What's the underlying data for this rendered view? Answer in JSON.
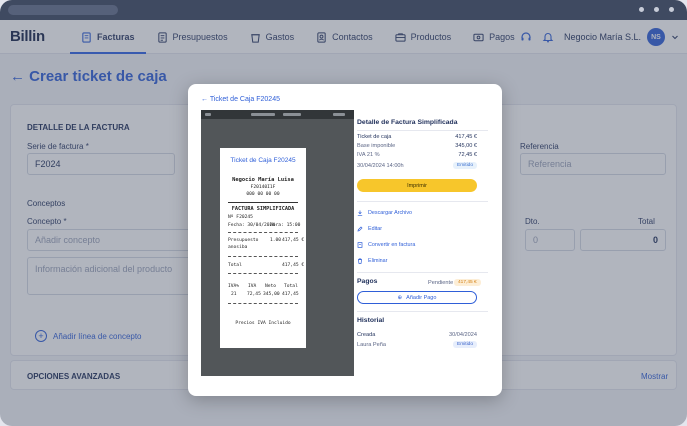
{
  "app": {
    "logo": "Billin"
  },
  "nav": [
    {
      "label": "Facturas",
      "icon": "invoice-icon",
      "active": true
    },
    {
      "label": "Presupuestos",
      "icon": "budget-icon"
    },
    {
      "label": "Gastos",
      "icon": "expenses-icon"
    },
    {
      "label": "Contactos",
      "icon": "contacts-icon"
    },
    {
      "label": "Productos",
      "icon": "products-icon"
    },
    {
      "label": "Pagos",
      "icon": "payments-icon"
    }
  ],
  "header": {
    "company": "Negocio María S.L.",
    "avatar": "NS"
  },
  "page": {
    "title": "← Crear ticket de caja",
    "detalle_title": "DETALLE DE LA FACTURA",
    "serie_label": "Serie de factura *",
    "serie_value": "F2024",
    "referencia_label": "Referencia",
    "referencia_placeholder": "Referencia",
    "conceptos_title": "Conceptos",
    "concepto_label": "Concepto *",
    "concepto_placeholder": "Añadir concepto",
    "info_placeholder": "Información adicional del producto",
    "dto_label": "Dto.",
    "dto_value": "0",
    "total_label": "Total",
    "total_value": "0",
    "add_line": "Añadir línea de concepto",
    "opciones": "OPCIONES AVANZADAS",
    "mostrar": "Mostrar"
  },
  "modal": {
    "back": "← Ticket de Caja F20245",
    "receipt": {
      "title": "Ticket de Caja F20245",
      "business": "Negocio María Luisa",
      "nif": "F20140I1F",
      "phone": "000 00 00 00",
      "doc_type": "FACTURA SIMPLIFICADA",
      "number": "Nº F20245",
      "date": "Fecha: 30/04/2024",
      "time": "Hora: 15:00",
      "item_name": "Presupuesto",
      "item_name2": "anosiba",
      "item_qty": "1.00",
      "item_total": "417,45 €",
      "total_label": "Total",
      "total_value": "417,45 €",
      "tax_headers": [
        "IVA%",
        "IVA",
        "Neto",
        "Total"
      ],
      "tax_row": [
        "21",
        "72,45",
        "345,00",
        "417,45"
      ],
      "footer": "Precios IVA Incluido"
    },
    "detail": {
      "title": "Detalle de Factura Simplificada",
      "rows": [
        {
          "label": "Ticket de caja",
          "value": "417,45 €"
        },
        {
          "label": "Base imponible",
          "value": "345,00 €"
        },
        {
          "label": "IVA 21 %",
          "value": "72,45 €"
        }
      ],
      "date": "30/04/2024 14:00h",
      "status": "Emitido",
      "print": "Imprimir",
      "actions": [
        {
          "label": "Descargar Archivo",
          "icon": "download-icon"
        },
        {
          "label": "Editar",
          "icon": "edit-icon"
        },
        {
          "label": "Convertir en factura",
          "icon": "convert-icon"
        },
        {
          "label": "Eliminar",
          "icon": "trash-icon"
        }
      ],
      "payments_title": "Pagos",
      "pending_label": "Pendiente",
      "pending_value": "417,45 €",
      "add_payment": "Añadir Pago",
      "history_title": "Historial",
      "history_event": "Creada",
      "history_date": "30/04/2024",
      "history_user": "Laura Peña",
      "history_status": "Emitido"
    }
  },
  "colors": {
    "accent": "#2f5fd8",
    "print_button": "#f7c62b"
  }
}
